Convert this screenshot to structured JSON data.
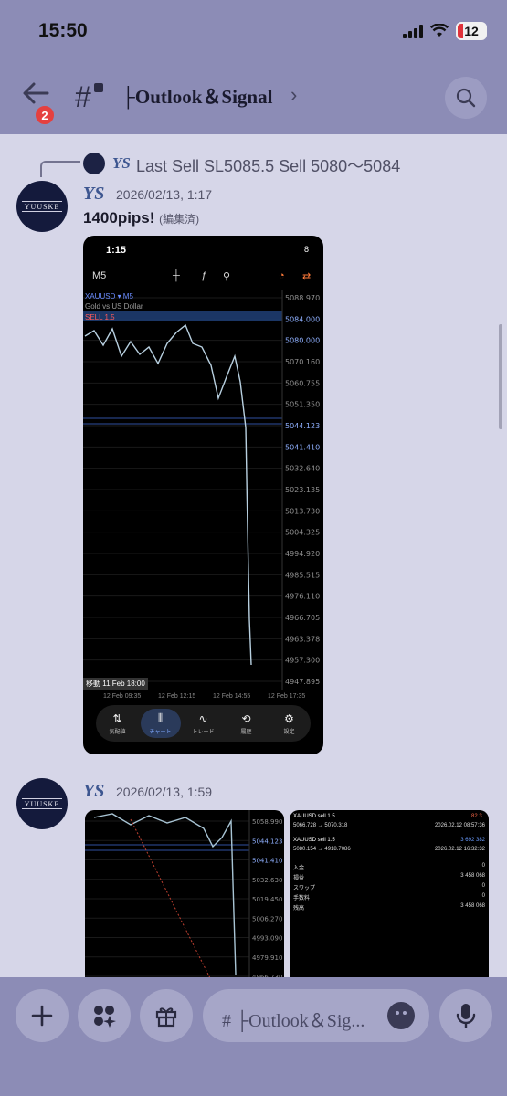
{
  "status": {
    "time": "15:50",
    "battery": "12"
  },
  "header": {
    "back_badge": "2",
    "channel": "├Outlook＆Signal",
    "chevron": "›"
  },
  "reply": {
    "name": "YS",
    "text": "Last Sell SL5085.5 Sell 5080〜5084"
  },
  "msg1": {
    "avatar_label": "YUUSKE",
    "name": "YS",
    "time": "2026/02/13, 1:17",
    "text": "1400pips!",
    "edited": "(編集済)"
  },
  "shot1": {
    "time": "1:15",
    "battery": "8",
    "timeframe": "M5",
    "symbol": "XAUUSD ▾ M5",
    "symbol_sub": "Gold vs US Dollar",
    "order_line": "SELL 1.5",
    "price_ticks": [
      "5088.970",
      "5084.000",
      "5080.000",
      "5070.160",
      "5060.755",
      "5051.350",
      "5044.123",
      "5041.410",
      "5032.640",
      "5023.135",
      "5013.730",
      "5004.325",
      "4994.920",
      "4985.515",
      "4976.110",
      "4966.705",
      "4963.378",
      "4957.300",
      "4947.895"
    ],
    "dates": [
      "12 Feb 09:35",
      "12 Feb 12:15",
      "12 Feb 14:55",
      "12 Feb 17:35"
    ],
    "move_label": "移動 11 Feb 18:00",
    "nav": [
      {
        "icon": "⇅",
        "label": "気配値"
      },
      {
        "icon": "⫴",
        "label": "チャート"
      },
      {
        "icon": "∿",
        "label": "トレード"
      },
      {
        "icon": "⟲",
        "label": "履歴"
      },
      {
        "icon": "⚙",
        "label": "設定"
      }
    ]
  },
  "msg2": {
    "avatar_label": "YUUSKE",
    "name": "YS",
    "time": "2026/02/13, 1:59"
  },
  "shot2": {
    "ticks": [
      "5058.990",
      "5044.123",
      "5041.410",
      "5032.630",
      "5019.450",
      "5006.270",
      "4993.090",
      "4979.910",
      "4966.730"
    ]
  },
  "shot3": {
    "trades": [
      {
        "symbol": "XAUUSD sell 1.5",
        "profit": "82 3..",
        "path": "5066.728 → 5070.318",
        "date": "2026.02.12 08:57:36"
      },
      {
        "symbol": "XAUUSD sell 1.5",
        "profit": "3 692 382",
        "path": "5080.154 → 4918.7086",
        "date": "2026.02.12 16:32:32"
      }
    ],
    "summary": [
      {
        "label": "入金",
        "value": "0"
      },
      {
        "label": "損益",
        "value": "3 458 068"
      },
      {
        "label": "スワップ",
        "value": "0"
      },
      {
        "label": "手数料",
        "value": "0"
      },
      {
        "label": "残高",
        "value": "3 458 068"
      }
    ]
  },
  "composer": {
    "placeholder": "# ├Outlook＆Sig..."
  },
  "colors": {
    "header": "#8c8cb6",
    "background": "#d6d6e8",
    "name": "#3d5690",
    "badge": "#e5403f"
  }
}
